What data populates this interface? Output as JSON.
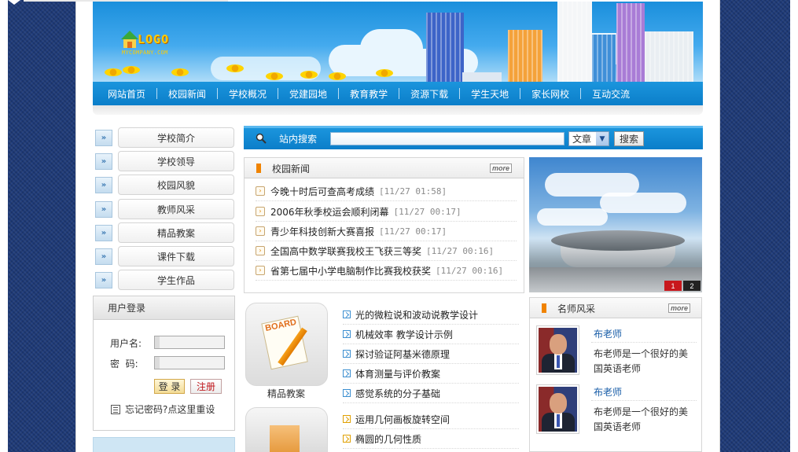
{
  "banner": {
    "logo_text": "LOGO",
    "logo_sub": "MYCOMPANY.COM"
  },
  "nav": {
    "items": [
      "网站首页",
      "校园新闻",
      "学校概况",
      "党建园地",
      "教育教学",
      "资源下载",
      "学生天地",
      "家长网校",
      "互动交流"
    ]
  },
  "sidebar": {
    "items": [
      "学校简介",
      "学校领导",
      "校园风貌",
      "教师风采",
      "精品教案",
      "课件下载",
      "学生作品"
    ]
  },
  "login": {
    "title": "用户登录",
    "username_label": "用户名:",
    "password_label": "密  码:",
    "login_button": "登 录",
    "register_button": "注册",
    "forgot_text": "忘记密码?点这里重设"
  },
  "search": {
    "label": "站内搜索",
    "input_value": "",
    "select_value": "文章",
    "button": "搜索"
  },
  "news": {
    "title": "校园新闻",
    "more": "more",
    "items": [
      {
        "title": "今晚十时后可查高考成绩",
        "time": "[11/27 01:58]"
      },
      {
        "title": "2006年秋季校运会顺利闭幕",
        "time": "[11/27 00:17]"
      },
      {
        "title": "青少年科技创新大赛喜报",
        "time": "[11/27 00:17]"
      },
      {
        "title": "全国高中数学联赛我校王飞获三等奖",
        "time": "[11/27 00:16]"
      },
      {
        "title": "省第七届中小学电脑制作比赛我校获奖",
        "time": "[11/27 00:16]"
      }
    ]
  },
  "photo": {
    "pages": [
      "1",
      "2"
    ]
  },
  "courseware": {
    "board_label": "BOARD",
    "caption": "精品教案",
    "items": [
      "光的微粒说和波动说教学设计",
      "机械效率 教学设计示例",
      "探讨验证阿基米德原理",
      "体育测量与评价教案",
      "感觉系统的分子基础"
    ],
    "items2": [
      "运用几何画板旋转空间",
      "椭圆的几何性质"
    ]
  },
  "teachers": {
    "title": "名师风采",
    "more": "more",
    "items": [
      {
        "name": "布老师",
        "desc": "布老师是一个很好的美国英语老师"
      },
      {
        "name": "布老师",
        "desc": "布老师是一个很好的美国英语老师"
      }
    ]
  },
  "colors": {
    "nav_blue": "#0b7ec9",
    "accent_orange": "#f08300",
    "link_blue": "#1a5ea8",
    "register_red": "#c0171c"
  }
}
